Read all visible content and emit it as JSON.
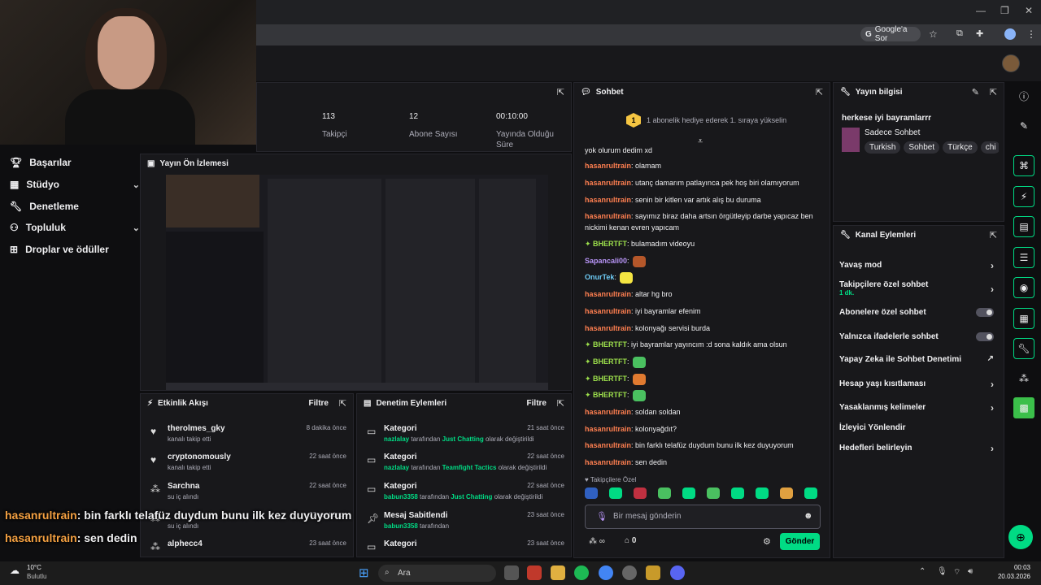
{
  "browser": {
    "google_ask": "Google'a Sor"
  },
  "stats": [
    {
      "value": "113",
      "label": "Takipçi"
    },
    {
      "value": "12",
      "label": "Abone Sayısı"
    },
    {
      "value": "00:10:00",
      "label": "Yayında Olduğu Süre"
    }
  ],
  "nav": [
    {
      "label": "Başarılar",
      "chevron": false
    },
    {
      "label": "Stüdyo",
      "chevron": true
    },
    {
      "label": "Denetleme",
      "chevron": false
    },
    {
      "label": "Topluluk",
      "chevron": true
    },
    {
      "label": "Droplar ve ödüller",
      "chevron": false
    }
  ],
  "preview": {
    "title": "Yayın Ön İzlemesi"
  },
  "activity": {
    "title": "Etkinlik Akışı",
    "filter": "Filtre",
    "items": [
      {
        "name": "therolmes_gky",
        "sub": "kanalı takip etti",
        "time": "8 dakika önce"
      },
      {
        "name": "cryptonomously",
        "sub": "kanalı takip etti",
        "time": "22 saat önce"
      },
      {
        "name": "Sarchna",
        "sub": "su iç alındı",
        "time": "22 saat önce"
      },
      {
        "name": "",
        "sub": "su iç alındı",
        "time": "22 saat önce"
      },
      {
        "name": "alphecc4",
        "sub": "",
        "time": "23 saat önce"
      }
    ]
  },
  "modlog": {
    "title": "Denetim Eylemleri",
    "filter": "Filtre",
    "items": [
      {
        "name": "Kategori",
        "user": "nazlalay",
        "mid": "tarafından",
        "target": "Just Chatting",
        "end": "olarak değiştirildi",
        "time": "21 saat önce"
      },
      {
        "name": "Kategori",
        "user": "nazlalay",
        "mid": "tarafından",
        "target": "Teamfight Tactics",
        "end": "olarak değiştirildi",
        "time": "22 saat önce"
      },
      {
        "name": "Kategori",
        "user": "babun3358",
        "mid": "tarafından",
        "target": "Just Chatting",
        "end": "olarak değiştirildi",
        "time": "22 saat önce"
      },
      {
        "name": "Mesaj Sabitlendi",
        "user": "babun3358",
        "mid": "tarafından",
        "target": "",
        "end": "",
        "time": "23 saat önce"
      },
      {
        "name": "Kategori",
        "user": "",
        "mid": "",
        "target": "",
        "end": "",
        "time": "23 saat önce"
      }
    ]
  },
  "chat": {
    "title": "Sohbet",
    "gift_banner": "1 abonelik hediye ederek 1. sıraya yükselin",
    "gift_rank": "1",
    "messages": [
      {
        "user": "",
        "text": "yok olurum dedim xd",
        "cls": "u-orange"
      },
      {
        "user": "hasanrultrain",
        "text": ": olamam",
        "cls": "u-orange"
      },
      {
        "user": "hasanrultrain",
        "text": ": utanç damarım patlayınca pek hoş biri olamıyorum",
        "cls": "u-orange"
      },
      {
        "user": "hasanrultrain",
        "text": ": senin bir kitlen var artık alış bu duruma",
        "cls": "u-orange"
      },
      {
        "user": "hasanrultrain",
        "text": ": sayımız biraz daha artsın örgütleyip darbe yapıcaz ben nickimi kenan evren yapıcam",
        "cls": "u-orange"
      },
      {
        "user": "BHERTFT",
        "text": ": bulamadım videoyu",
        "cls": "u-green"
      },
      {
        "user": "Sapancali00",
        "text": ":",
        "cls": "u-purple"
      },
      {
        "user": "OnurTek",
        "text": ":",
        "cls": "u-cyan"
      },
      {
        "user": "hasanrultrain",
        "text": ": altar hg bro",
        "cls": "u-orange"
      },
      {
        "user": "hasanrultrain",
        "text": ": iyi bayramlar efenim",
        "cls": "u-orange"
      },
      {
        "user": "hasanrultrain",
        "text": ": kolonyağı servisi burda",
        "cls": "u-orange"
      },
      {
        "user": "BHERTFT",
        "text": ": iyi bayramlar yayıncım :d sona kaldık ama olsun",
        "cls": "u-green"
      },
      {
        "user": "BHERTFT",
        "text": ":",
        "cls": "u-green"
      },
      {
        "user": "BHERTFT",
        "text": ":",
        "cls": "u-green"
      },
      {
        "user": "BHERTFT",
        "text": ":",
        "cls": "u-green"
      },
      {
        "user": "hasanrultrain",
        "text": ": soldan soldan",
        "cls": "u-orange"
      },
      {
        "user": "hasanrultrain",
        "text": ": kolonyağdıt?",
        "cls": "u-orange"
      },
      {
        "user": "hasanrultrain",
        "text": ": bin farklı telafüz duydum bunu ilk kez duyuyorum",
        "cls": "u-orange"
      },
      {
        "user": "hasanrultrain",
        "text": ": sen dedin",
        "cls": "u-orange"
      }
    ],
    "followers_only": "Takipçilere Özel",
    "placeholder": "Bir mesaj gönderin",
    "points": "0",
    "send": "Gönder"
  },
  "stream_info": {
    "title": "Yayın bilgisi",
    "stream_title": "herkese iyi bayramlarrr",
    "category": "Sadece Sohbet",
    "tags": [
      "Turkish",
      "Sohbet",
      "Türkçe",
      "chi"
    ]
  },
  "channel_actions": {
    "title": "Kanal Eylemleri",
    "items": [
      {
        "label": "Yavaş mod",
        "kind": "chevron",
        "sub": ""
      },
      {
        "label": "Takipçilere özel sohbet",
        "kind": "chevron",
        "sub": "1 dk."
      },
      {
        "label": "Abonelere özel sohbet",
        "kind": "toggle",
        "sub": ""
      },
      {
        "label": "Yalnızca ifadelerle sohbet",
        "kind": "toggle",
        "sub": ""
      },
      {
        "label": "Yapay Zeka ile Sohbet Denetimi",
        "kind": "external",
        "sub": ""
      },
      {
        "label": "Hesap yaşı kısıtlaması",
        "kind": "chevron",
        "sub": ""
      },
      {
        "label": "Yasaklanmış kelimeler",
        "kind": "chevron",
        "sub": ""
      },
      {
        "label": "İzleyici Yönlendir",
        "kind": "none",
        "sub": ""
      },
      {
        "label": "Hedefleri belirleyin",
        "kind": "chevron",
        "sub": ""
      }
    ]
  },
  "overlay": [
    {
      "user": "hasanrultrain",
      "text": ": bin farklı telafüz duydum bunu ilk kez duyuyorum"
    },
    {
      "user": "hasanrultrain",
      "text": ": sen dedin"
    }
  ],
  "taskbar": {
    "weather_temp": "10°C",
    "weather_desc": "Bulutlu",
    "search": "Ara",
    "time": "00:03",
    "date": "20.03.2026"
  }
}
